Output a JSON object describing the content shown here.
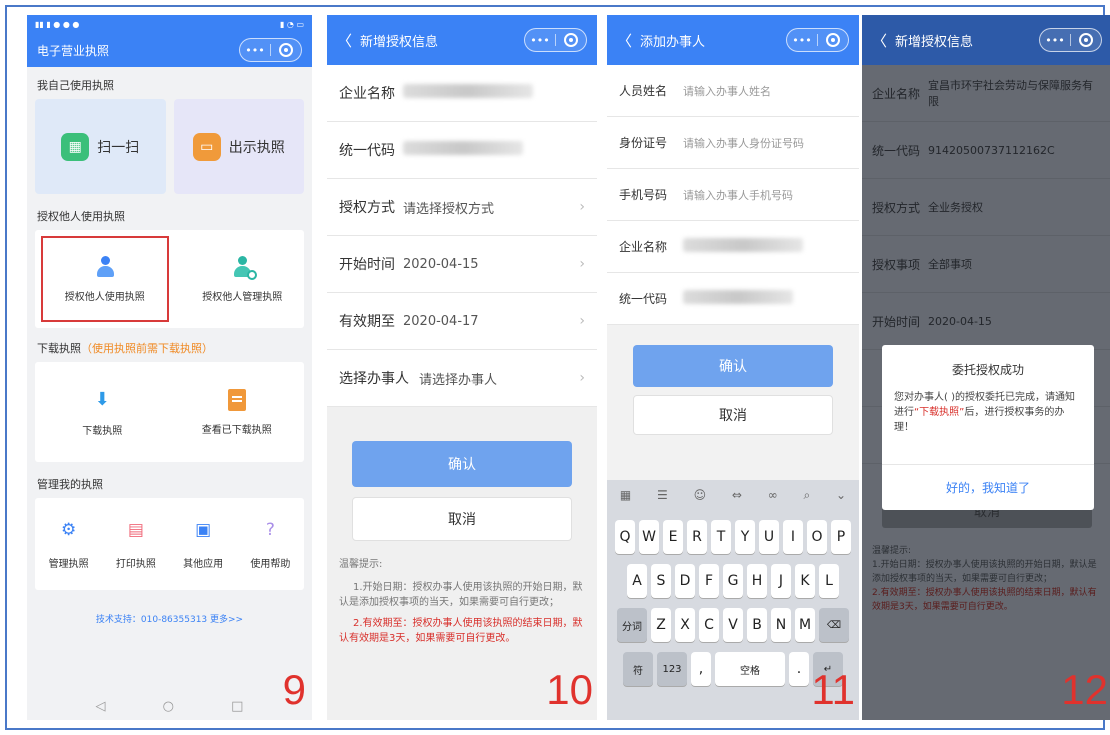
{
  "panel9": {
    "app_title": "电子营业执照",
    "section_self": "我自己使用执照",
    "scan_label": "扫一扫",
    "show_label": "出示执照",
    "section_authorize": "授权他人使用执照",
    "authorize_use": "授权他人使用执照",
    "authorize_manage": "授权他人管理执照",
    "section_download": "下载执照",
    "section_download_note": "（使用执照前需下载执照）",
    "download_label": "下载执照",
    "view_downloaded": "查看已下载执照",
    "section_manage": "管理我的执照",
    "manage_items": [
      "管理执照",
      "打印执照",
      "其他应用",
      "使用帮助"
    ],
    "support_text": "技术支持：010-86355313 更多>>",
    "page_number": "9"
  },
  "panel10": {
    "title": "新增授权信息",
    "rows": [
      {
        "label": "企业名称",
        "value": ""
      },
      {
        "label": "统一代码",
        "value": ""
      },
      {
        "label": "授权方式",
        "value": "请选择授权方式"
      },
      {
        "label": "开始时间",
        "value": "2020-04-15"
      },
      {
        "label": "有效期至",
        "value": "2020-04-17"
      },
      {
        "label": "选择办事人",
        "value": "请选择办事人"
      }
    ],
    "confirm": "确认",
    "cancel": "取消",
    "tips_title": "温馨提示:",
    "tip1": "1.开始日期：授权办事人使用该执照的开始日期，默认是添加授权事项的当天，如果需要可自行更改；",
    "tip2": "2.有效期至：授权办事人使用该执照的结束日期，默认有效期是3天，如果需要可自行更改。",
    "page_number": "10"
  },
  "panel11": {
    "title": "添加办事人",
    "rows": [
      {
        "label": "人员姓名",
        "placeholder": "请输入办事人姓名"
      },
      {
        "label": "身份证号",
        "placeholder": "请输入办事人身份证号码"
      },
      {
        "label": "手机号码",
        "placeholder": "请输入办事人手机号码"
      },
      {
        "label": "企业名称",
        "placeholder": ""
      },
      {
        "label": "统一代码",
        "placeholder": ""
      }
    ],
    "confirm": "确认",
    "cancel": "取消",
    "keyboard": {
      "row1": [
        "Q",
        "W",
        "E",
        "R",
        "T",
        "Y",
        "U",
        "I",
        "O",
        "P"
      ],
      "row2": [
        "A",
        "S",
        "D",
        "F",
        "G",
        "H",
        "J",
        "K",
        "L"
      ],
      "row3_left": "分词",
      "row3": [
        "Z",
        "X",
        "C",
        "V",
        "B",
        "N",
        "M"
      ],
      "row4_symbol": "符",
      "row4_num": "123",
      "space": "空格"
    },
    "page_number": "11"
  },
  "panel12": {
    "title": "新增授权信息",
    "rows": [
      {
        "label": "企业名称",
        "value": "宜昌市环宇社会劳动与保障服务有限"
      },
      {
        "label": "统一代码",
        "value": "91420500737112162C"
      },
      {
        "label": "授权方式",
        "value": "全业务授权"
      },
      {
        "label": "授权事项",
        "value": "全部事项"
      },
      {
        "label": "开始时间",
        "value": "2020-04-15"
      }
    ],
    "dialog_title": "委托授权成功",
    "dialog_body_1": "您对办事人(      )的授权委托已完成，请通知      进行",
    "dialog_body_highlight": "“下载执照”",
    "dialog_body_2": "后，进行授权事务的办理！",
    "dialog_ok": "好的，我知道了",
    "cancel": "取消",
    "tips_title": "温馨提示:",
    "tip1": "1.开始日期：授权办事人使用该执照的开始日期，默认是添加授权事项的当天，如果需要可自行更改；",
    "tip2": "2.有效期至：授权办事人使用该执照的结束日期，默认有效期是3天，如果需要可自行更改。",
    "page_number": "12"
  }
}
